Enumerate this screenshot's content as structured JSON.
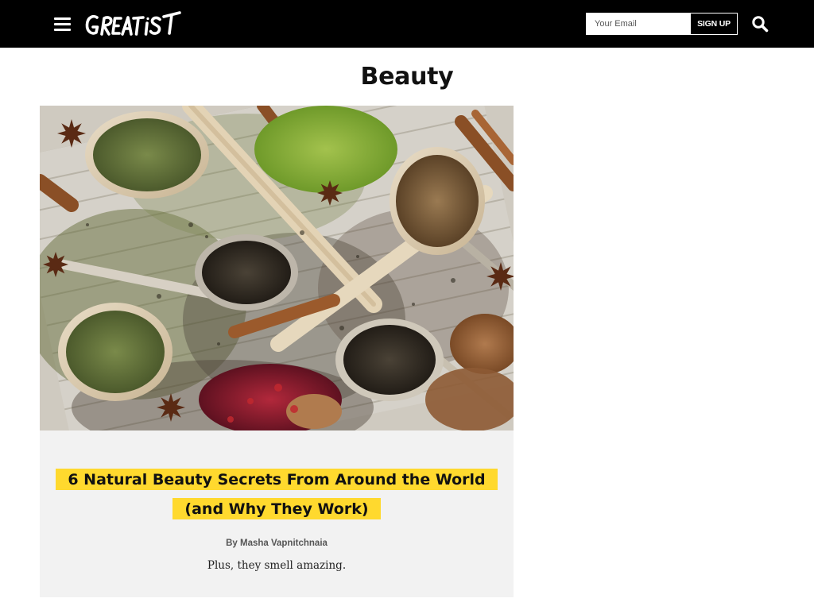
{
  "header": {
    "logo_text": "GREATIST",
    "email_placeholder": "Your Email",
    "signup_label": "SIGN UP",
    "icons": {
      "menu": "hamburger-menu-icon",
      "search": "magnifying-glass-icon"
    },
    "colors": {
      "bar_background": "#000000",
      "text": "#ffffff"
    }
  },
  "page": {
    "title": "Beauty"
  },
  "article": {
    "image_description": "",
    "headline_lines": [
      "6 Natural Beauty Secrets From Around the World",
      "(and Why They Work)"
    ],
    "byline_prefix": "By",
    "author": "Masha Vapnitchnaia",
    "dek": "Plus, they smell amazing.",
    "colors": {
      "highlight": "#ffd92e",
      "card_background": "#f2f2f2"
    }
  }
}
